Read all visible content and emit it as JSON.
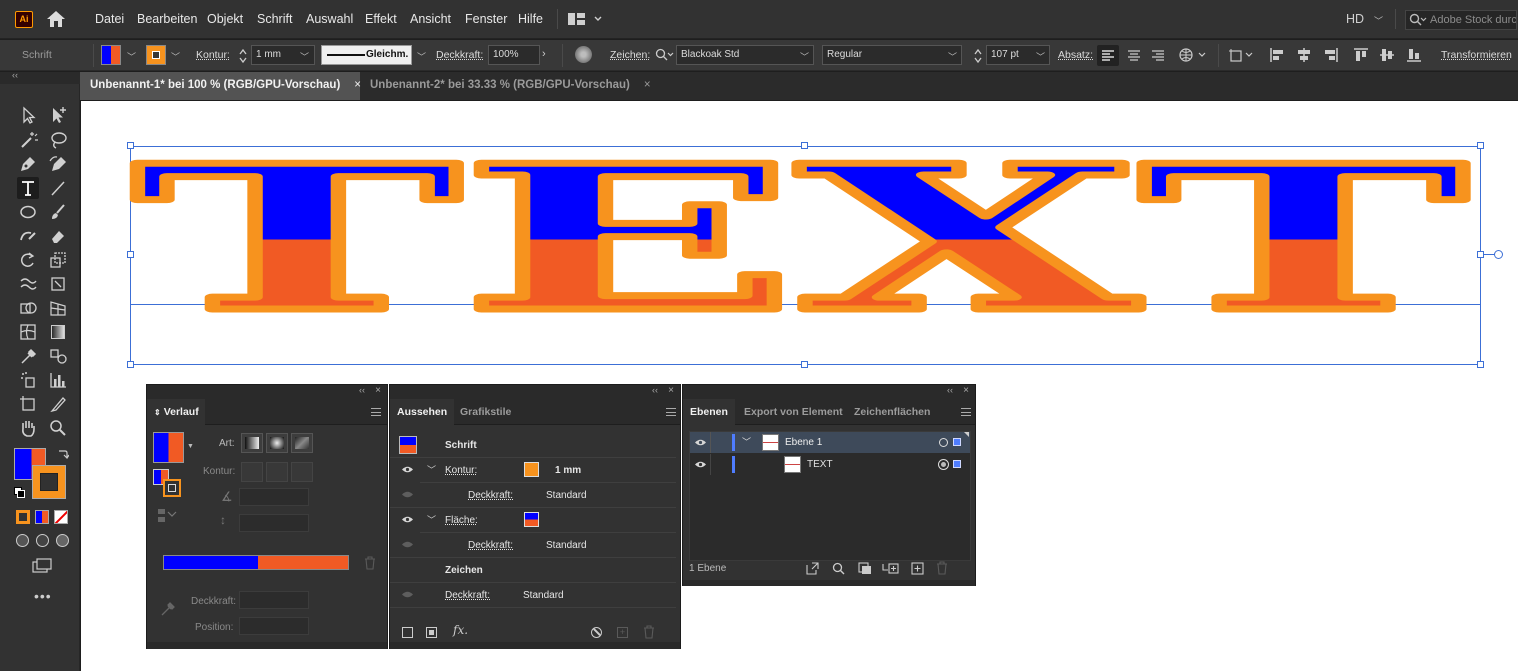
{
  "app": {
    "logo": "Ai"
  },
  "menu": [
    "Datei",
    "Bearbeiten",
    "Objekt",
    "Schrift",
    "Auswahl",
    "Effekt",
    "Ansicht",
    "Fenster",
    "Hilfe"
  ],
  "workspace": {
    "label": "HD"
  },
  "search": {
    "placeholder": "Adobe Stock durchsuchen"
  },
  "control": {
    "type_label": "Schrift",
    "stroke_label": "Kontur:",
    "stroke_value": "1 mm",
    "stroke_profile": "Gleichm.",
    "opacity_label": "Deckkraft:",
    "opacity_value": "100%",
    "char_label": "Zeichen:",
    "font_family": "Blackoak Std",
    "font_style": "Regular",
    "font_size": "107 pt",
    "para_label": "Absatz:",
    "transform_label": "Transformieren"
  },
  "tabs": [
    {
      "title": "Unbenannt-1* bei 100 % (RGB/GPU-Vorschau)",
      "close": "×"
    },
    {
      "title": "Unbenannt-2* bei 33.33 % (RGB/GPU-Vorschau)",
      "close": "×"
    }
  ],
  "artwork": {
    "text": "TEXT",
    "colors": {
      "top": "#0000ff",
      "bottom": "#f15a24",
      "stroke": "#f7931e"
    }
  },
  "gradient_panel": {
    "tab": "Verlauf",
    "type_label": "Art:",
    "stroke_label": "Kontur:",
    "opacity_label": "Deckkraft:",
    "position_label": "Position:",
    "colors": {
      "start": "#0000ff",
      "end": "#f15a24"
    }
  },
  "appearance_panel": {
    "tabs": [
      "Aussehen",
      "Grafikstile"
    ],
    "title": "Schrift",
    "rows": {
      "stroke_label": "Kontur:",
      "stroke_value": "1 mm",
      "stroke_opacity_label": "Deckkraft:",
      "stroke_opacity_value": "Standard",
      "fill_label": "Fläche:",
      "fill_opacity_label": "Deckkraft:",
      "fill_opacity_value": "Standard",
      "characters": "Zeichen",
      "opacity_label": "Deckkraft:",
      "opacity_value": "Standard"
    },
    "fx": "fx."
  },
  "layers_panel": {
    "tabs": [
      "Ebenen",
      "Export von Element",
      "Zeichenflächen"
    ],
    "layers": [
      {
        "name": "Ebene 1"
      },
      {
        "name": "TEXT"
      }
    ],
    "footer": "1 Ebene"
  }
}
